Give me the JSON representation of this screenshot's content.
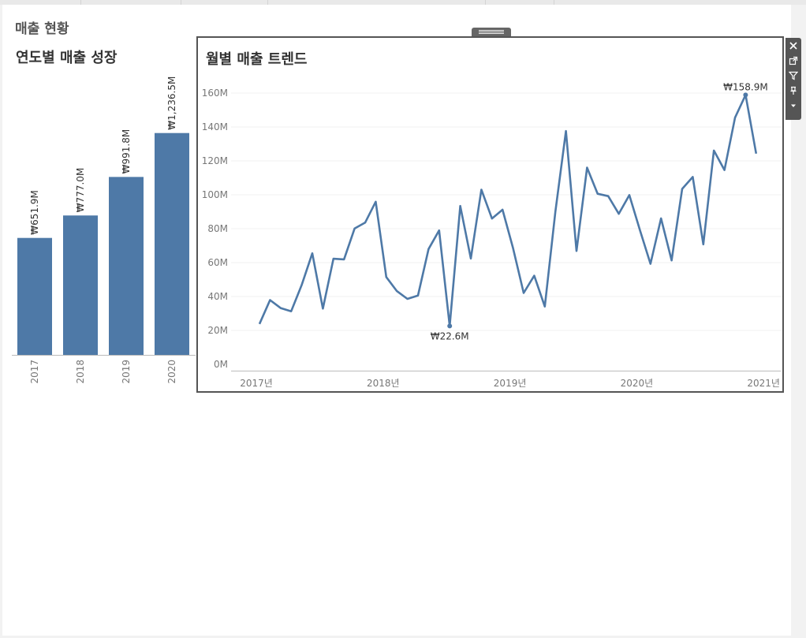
{
  "dashboard": {
    "title": "매출 현황"
  },
  "colors": {
    "series": "#4e79a7",
    "axis": "#bbbbbb",
    "grid": "#f0f0f0",
    "tick": "#777777"
  },
  "toolbar": {
    "icons": [
      "close-icon",
      "popout-icon",
      "filter-icon",
      "pin-icon",
      "more-options-icon"
    ]
  },
  "chart_data": [
    {
      "type": "bar",
      "title": "연도별 매출 성장",
      "categories": [
        "2017",
        "2018",
        "2019",
        "2020"
      ],
      "values": [
        651.9,
        777.0,
        991.8,
        1236.5
      ],
      "data_labels": [
        "₩651.9M",
        "₩777.0M",
        "₩991.8M",
        "₩1,236.5M"
      ],
      "unit": "M",
      "ylim": [
        0,
        1600
      ],
      "grid": false,
      "label_orientation": "vertical"
    },
    {
      "type": "line",
      "title": "월별 매출 트렌드",
      "x_start": "2017-01",
      "x_end": "2020-12",
      "x_ticks": [
        "2017년",
        "2018년",
        "2019년",
        "2020년",
        "2021년"
      ],
      "y_ticks": [
        "0M",
        "20M",
        "40M",
        "60M",
        "80M",
        "100M",
        "120M",
        "140M",
        "160M"
      ],
      "ylim": [
        0,
        160
      ],
      "grid": true,
      "series": [
        {
          "values": [
            23.8,
            37.9,
            33.2,
            31.3,
            46.9,
            65.5,
            32.9,
            62.3,
            61.9,
            80.1,
            83.6,
            95.9,
            51.5,
            43.2,
            38.6,
            40.6,
            68.0,
            79.0,
            22.6,
            93.4,
            62.4,
            103.0,
            86.0,
            91.2,
            68.4,
            42.1,
            52.3,
            34.1,
            90.0,
            137.6,
            66.9,
            116.0,
            100.6,
            99.2,
            88.8,
            99.8,
            79.2,
            59.3,
            86.1,
            61.3,
            103.5,
            110.5,
            70.8,
            126.1,
            114.6,
            145.5,
            158.9,
            124.3
          ]
        }
      ],
      "annotations": [
        {
          "label": "₩22.6M",
          "index": 18,
          "value": 22.6
        },
        {
          "label": "₩158.9M",
          "index": 46,
          "value": 158.9
        }
      ]
    }
  ]
}
